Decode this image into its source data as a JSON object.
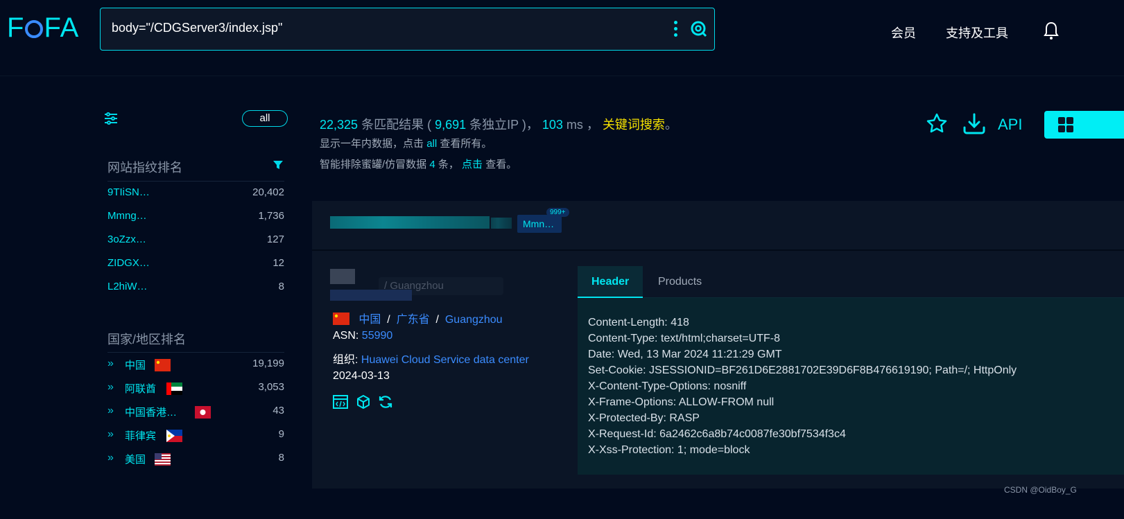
{
  "header": {
    "logo": "FOFA",
    "query": "body=\"/CDGServer3/index.jsp\"",
    "nav": [
      "会员",
      "支持及工具"
    ]
  },
  "sidebar": {
    "all_label": "all",
    "fingerprint_title": "网站指纹排名",
    "fingerprints": [
      {
        "name": "9TIiSN…",
        "count": "20,402"
      },
      {
        "name": "Mmng…",
        "count": "1,736"
      },
      {
        "name": "3oZzx…",
        "count": "127"
      },
      {
        "name": "ZIDGX…",
        "count": "12"
      },
      {
        "name": "L2hiW…",
        "count": "8"
      }
    ],
    "country_title": "国家/地区排名",
    "countries": [
      {
        "name": "中国",
        "count": "19,199",
        "flag": "cn"
      },
      {
        "name": "阿联酋",
        "count": "3,053",
        "flag": "ae"
      },
      {
        "name": "中国香港…",
        "count": "43",
        "flag": "hk"
      },
      {
        "name": "菲律宾",
        "count": "9",
        "flag": "ph"
      },
      {
        "name": "美国",
        "count": "8",
        "flag": "us"
      }
    ]
  },
  "stats": {
    "total": "22,325",
    "total_label": "条匹配结果 (",
    "unique_ip": "9,691",
    "unique_label": "条独立IP )，",
    "ms": "103",
    "ms_label": "ms ，",
    "keyword": "关键词搜索",
    "end": "。",
    "line2_a": "显示一年内数据，点击",
    "line2_all": "all",
    "line2_b": "查看所有。",
    "line3_a": "智能排除蜜罐/仿冒数据",
    "line3_n": "4",
    "line3_b": "条，",
    "line3_click": "点击",
    "line3_c": "查看。"
  },
  "tools": {
    "api": "API"
  },
  "result": {
    "tag": "Mmn…",
    "badge": "999+",
    "ghost_location": "/ Guangzhou",
    "country": "中国",
    "province": "广东省",
    "city": "Guangzhou",
    "sep": "/",
    "asn_label": "ASN:",
    "asn": "55990",
    "org_label": "组织:",
    "org": "Huawei Cloud Service data center",
    "date": "2024-03-13",
    "tabs": [
      "Header",
      "Products"
    ],
    "header_lines": [
      "Content-Length: 418",
      "Content-Type: text/html;charset=UTF-8",
      "Date: Wed, 13 Mar 2024 11:21:29 GMT",
      "Set-Cookie: JSESSIONID=BF261D6E2881702E39D6F8B476619190; Path=/; HttpOnly",
      "X-Content-Type-Options: nosniff",
      "X-Frame-Options: ALLOW-FROM null",
      "X-Protected-By: RASP",
      "X-Request-Id: 6a2462c6a8b74c0087fe30bf7534f3c4",
      "X-Xss-Protection: 1; mode=block"
    ]
  },
  "watermark": "CSDN @OidBoy_G",
  "colors": {
    "accent": "#00e6f0",
    "link": "#3b8cff",
    "keyword": "#f5e100",
    "background": "#020b1e"
  }
}
